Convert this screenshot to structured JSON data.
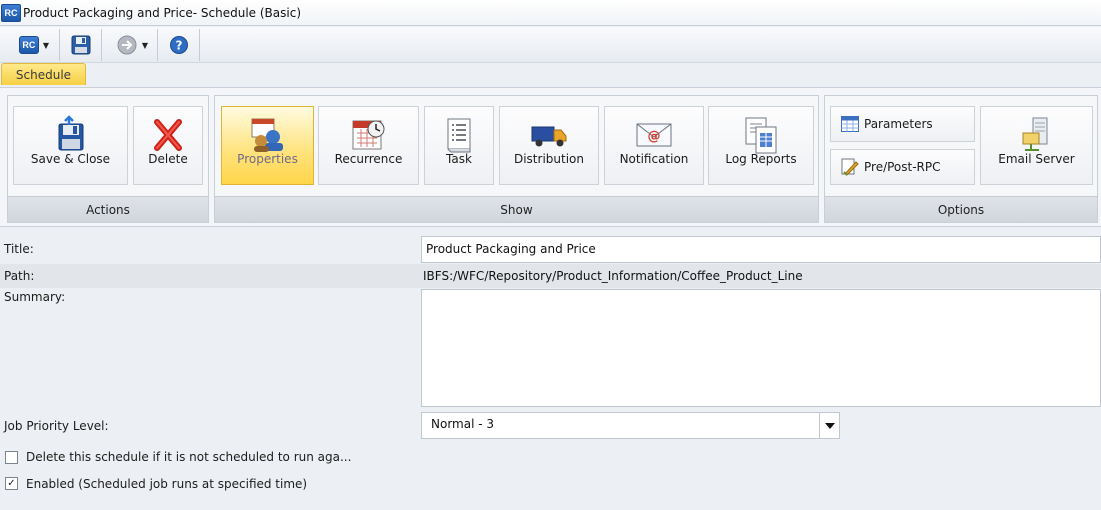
{
  "window": {
    "title": "Product Packaging and Price- Schedule (Basic)",
    "app_badge": "RC"
  },
  "qat": {
    "rc_badge": "RC"
  },
  "tabs": [
    {
      "label": "Schedule",
      "active": true
    }
  ],
  "ribbon": {
    "groups": {
      "actions": {
        "label": "Actions",
        "buttons": [
          {
            "label": "Save & Close",
            "icon": "save-close-icon"
          },
          {
            "label": "Delete",
            "icon": "delete-x-icon"
          }
        ]
      },
      "show": {
        "label": "Show",
        "buttons": [
          {
            "label": "Properties",
            "icon": "properties-icon",
            "active": true
          },
          {
            "label": "Recurrence",
            "icon": "calendar-clock-icon"
          },
          {
            "label": "Task",
            "icon": "task-list-icon"
          },
          {
            "label": "Distribution",
            "icon": "truck-icon"
          },
          {
            "label": "Notification",
            "icon": "email-at-icon"
          },
          {
            "label": "Log Reports",
            "icon": "log-documents-icon"
          }
        ]
      },
      "options": {
        "label": "Options",
        "buttons": [
          {
            "label": "Parameters",
            "icon": "table-grid-icon"
          },
          {
            "label": "Pre/Post-RPC",
            "icon": "pencil-document-icon"
          },
          {
            "label": "Email Server",
            "icon": "server-icon"
          }
        ]
      }
    }
  },
  "form": {
    "title": {
      "label": "Title:",
      "value": "Product Packaging and Price"
    },
    "path": {
      "label": "Path:",
      "value": "IBFS:/WFC/Repository/Product_Information/Coffee_Product_Line"
    },
    "summary": {
      "label": "Summary:",
      "value": ""
    },
    "priority": {
      "label": "Job Priority Level:",
      "value": "Normal - 3"
    },
    "delete_if_not_scheduled": {
      "label": "Delete this schedule if it is not scheduled to run aga...",
      "checked": false
    },
    "enabled": {
      "label": "Enabled (Scheduled job runs at specified time)",
      "checked": true,
      "check_mark": "✓"
    }
  },
  "colors": {
    "active_tab": "#f6cf45",
    "ribbon_group_bg": "#f6f7f9",
    "brand_blue": "#1d57a8"
  }
}
